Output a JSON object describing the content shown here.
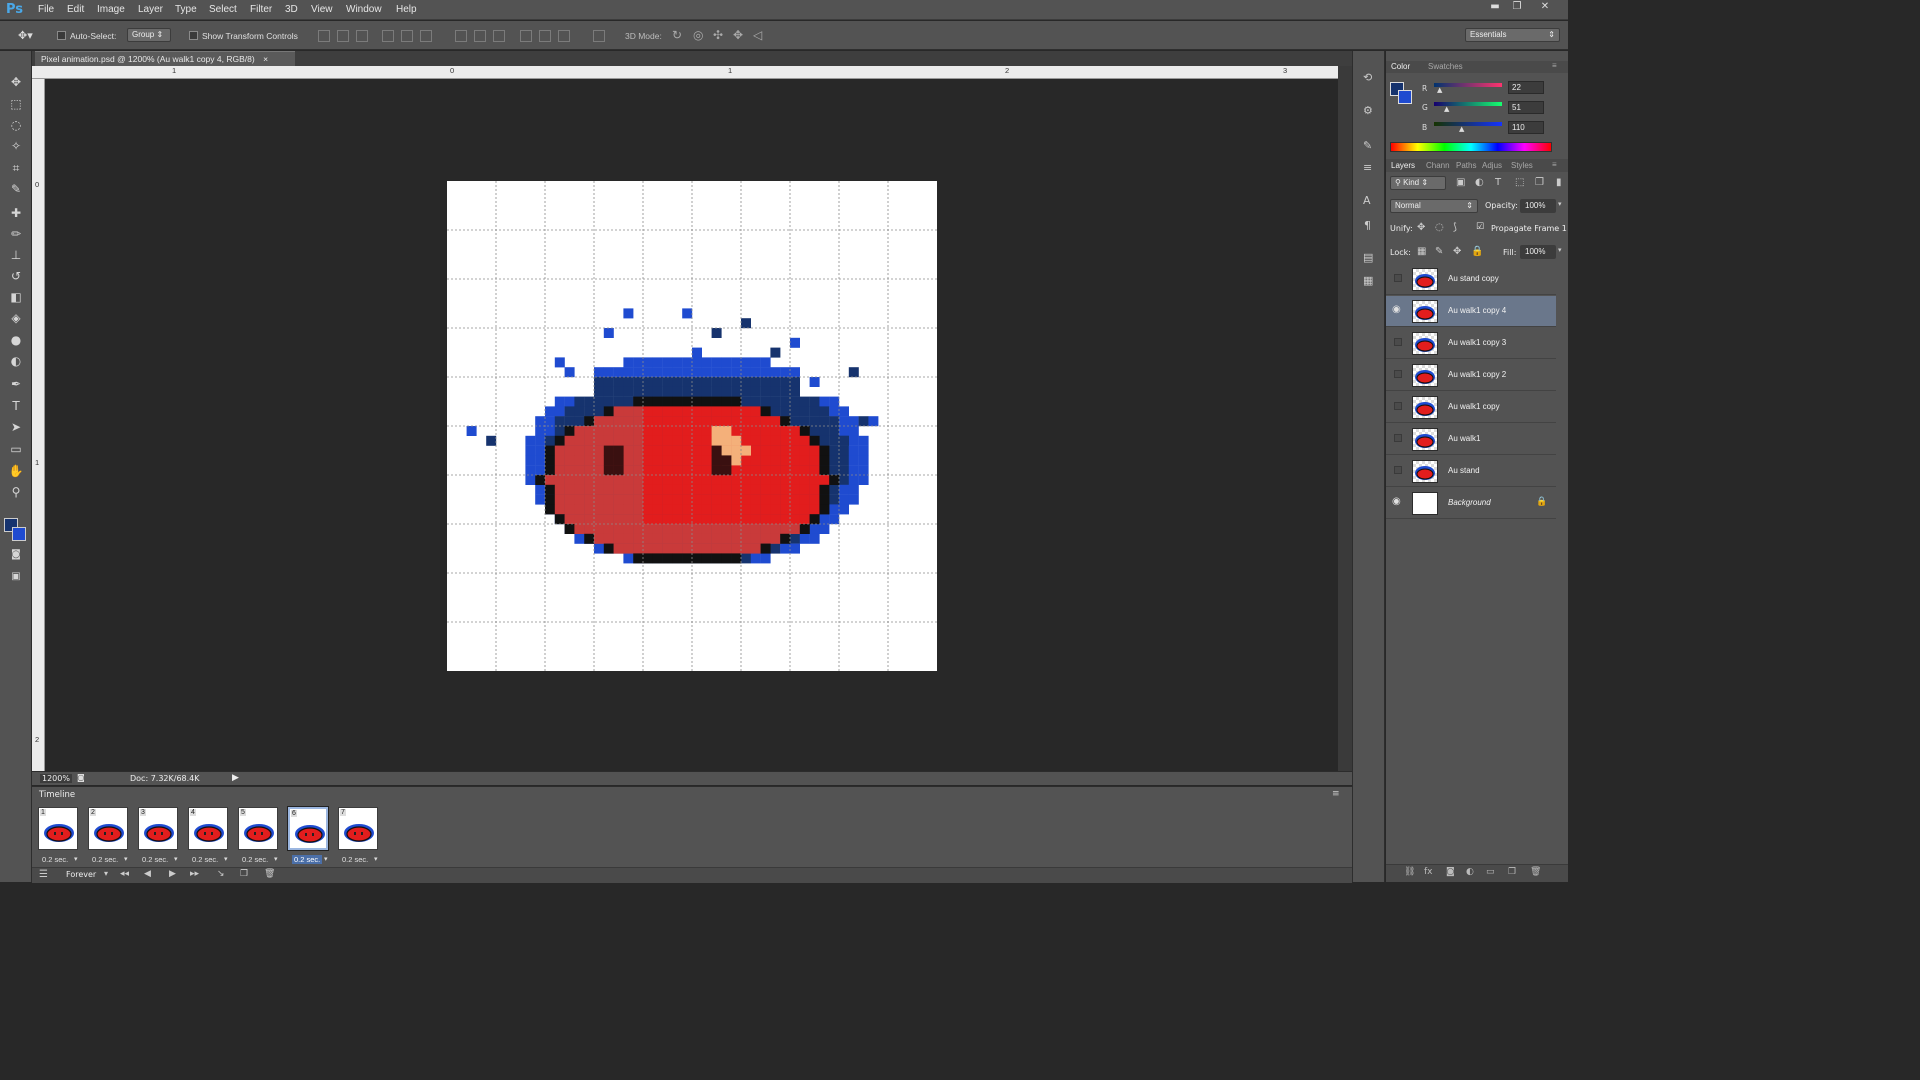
{
  "app": {
    "logo": "Ps"
  },
  "menu": [
    "File",
    "Edit",
    "Image",
    "Layer",
    "Type",
    "Select",
    "Filter",
    "3D",
    "View",
    "Window",
    "Help"
  ],
  "window_controls": {
    "minimize": "▬",
    "restore": "❐",
    "close": "✕"
  },
  "options": {
    "auto_select_label": "Auto-Select:",
    "auto_select_value": "Group",
    "show_transform_label": "Show Transform Controls",
    "mode_3d_label": "3D Mode:",
    "workspace": "Essentials"
  },
  "document": {
    "tab_title": "Pixel animation.psd @ 1200% (Au walk1 copy 4, RGB/8)",
    "close_glyph": "×",
    "ruler_h": [
      "1",
      "0",
      "1",
      "2",
      "3"
    ],
    "ruler_v": [
      "0",
      "1",
      "2"
    ],
    "zoom": "1200%",
    "doc_size": "Doc: 7.32K/68.4K"
  },
  "timeline": {
    "title": "Timeline",
    "frames": [
      {
        "num": "1",
        "delay": "0.2 sec."
      },
      {
        "num": "2",
        "delay": "0.2 sec."
      },
      {
        "num": "3",
        "delay": "0.2 sec."
      },
      {
        "num": "4",
        "delay": "0.2 sec."
      },
      {
        "num": "5",
        "delay": "0.2 sec."
      },
      {
        "num": "6",
        "delay": "0.2 sec."
      },
      {
        "num": "7",
        "delay": "0.2 sec."
      }
    ],
    "selected_frame": 6,
    "loop": "Forever"
  },
  "color_panel": {
    "tabs": [
      "Color",
      "Swatches"
    ],
    "r_label": "R",
    "g_label": "G",
    "b_label": "B",
    "r": "22",
    "g": "51",
    "b": "110",
    "foreground": "#16336e",
    "background": "#1f4bd0"
  },
  "layers_panel": {
    "tabs": [
      "Layers",
      "Chann",
      "Paths",
      "Adjus",
      "Styles"
    ],
    "filter_kind": "Kind",
    "blend_mode": "Normal",
    "opacity_label": "Opacity:",
    "opacity": "100%",
    "unify_label": "Unify:",
    "propagate_label": "Propagate Frame 1",
    "lock_label": "Lock:",
    "fill_label": "Fill:",
    "fill": "100%",
    "layers": [
      {
        "name": "Au stand copy",
        "visible": false,
        "selected": false
      },
      {
        "name": "Au walk1 copy 4",
        "visible": true,
        "selected": true
      },
      {
        "name": "Au walk1 copy 3",
        "visible": false,
        "selected": false
      },
      {
        "name": "Au walk1 copy 2",
        "visible": false,
        "selected": false
      },
      {
        "name": "Au walk1 copy",
        "visible": false,
        "selected": false
      },
      {
        "name": "Au walk1",
        "visible": false,
        "selected": false
      },
      {
        "name": "Au stand",
        "visible": false,
        "selected": false
      },
      {
        "name": "Background",
        "visible": true,
        "selected": false,
        "locked": true
      }
    ]
  }
}
